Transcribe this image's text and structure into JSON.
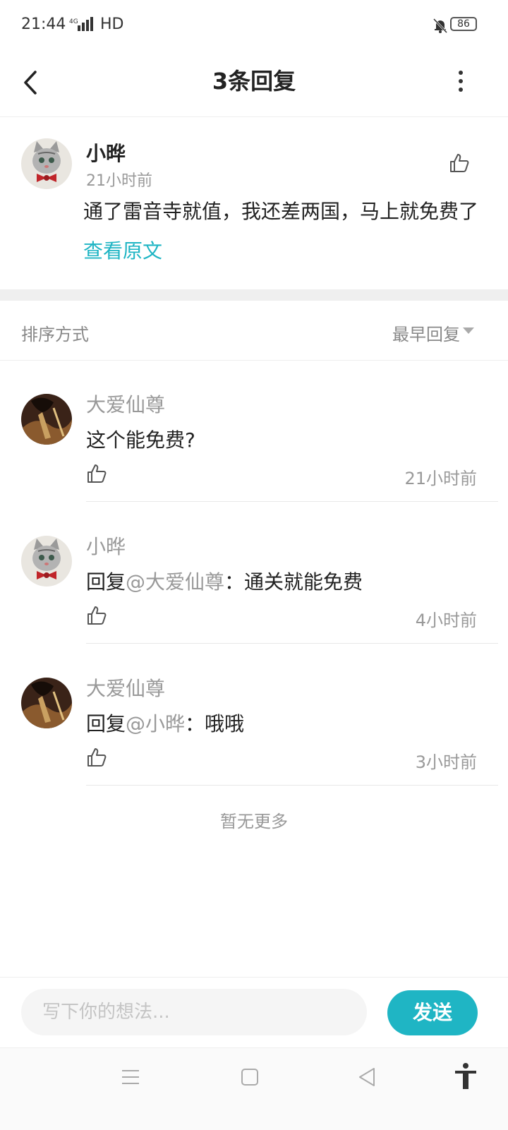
{
  "status_bar": {
    "time": "21:44",
    "network": "4G",
    "hd": "HD",
    "battery": "86"
  },
  "header": {
    "title": "3条回复"
  },
  "original": {
    "author": "小晔",
    "time": "21小时前",
    "text": "通了雷音寺就值，我还差两国，马上就免费了",
    "view_original": "查看原文"
  },
  "sort": {
    "label": "排序方式",
    "value": "最早回复"
  },
  "replies": [
    {
      "author": "大爱仙尊",
      "prefix": "",
      "mention": "",
      "text": "这个能免费?",
      "time": "21小时前"
    },
    {
      "author": "小晔",
      "prefix": "回复",
      "mention": "@大爱仙尊",
      "text": "：通关就能免费",
      "time": "4小时前"
    },
    {
      "author": "大爱仙尊",
      "prefix": "回复",
      "mention": "@小晔",
      "text": "：哦哦",
      "time": "3小时前"
    }
  ],
  "footer_note": "暂无更多",
  "composer": {
    "placeholder": "写下你的想法...",
    "send_label": "发送"
  },
  "colors": {
    "accent": "#1fb5c4",
    "muted": "#999999"
  }
}
